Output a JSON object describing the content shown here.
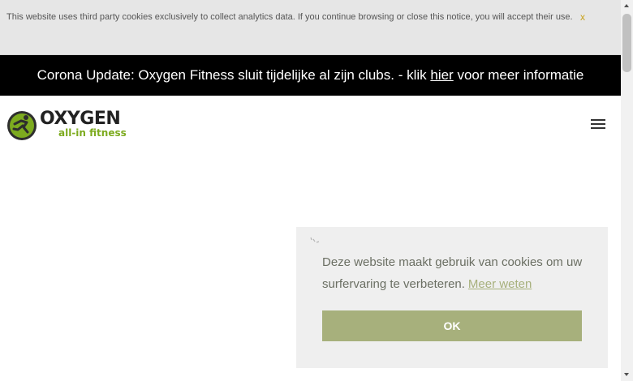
{
  "notice": {
    "text": "This website uses third party cookies exclusively to collect analytics data. If you continue browsing or close this notice, you will accept their use.",
    "close_label": "x"
  },
  "banner": {
    "prefix": "Corona Update: Oxygen Fitness sluit tijdelijke al zijn clubs. - klik ",
    "link_label": "hier",
    "suffix": " voor meer informatie"
  },
  "header": {
    "logo_word": "OXYGEN",
    "logo_tagline": "all-in fitness",
    "menu_icon": "hamburger-menu-icon"
  },
  "cookie_popup": {
    "message": "Deze website maakt gebruik van cookies om uw surfervaring te verbeteren.",
    "link_label": "Meer weten",
    "ok_label": "OK"
  },
  "colors": {
    "banner_bg": "#000000",
    "notice_bg": "#e6e6e6",
    "brand_green": "#7dab1f",
    "cookie_button": "#a7b07c",
    "cookie_bg": "#efefef"
  }
}
